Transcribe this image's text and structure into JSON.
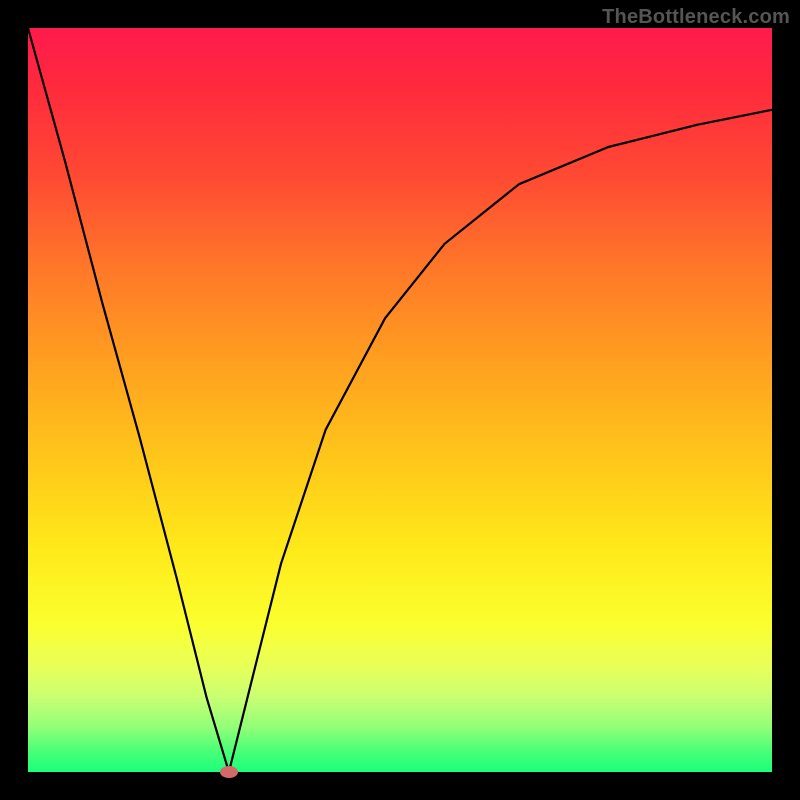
{
  "watermark": "TheBottleneck.com",
  "chart_data": {
    "type": "line",
    "title": "",
    "xlabel": "",
    "ylabel": "",
    "xlim": [
      0,
      100
    ],
    "ylim": [
      0,
      100
    ],
    "grid": false,
    "background_gradient": {
      "top": "#ff1a4d",
      "bottom": "#1aff7a",
      "description": "vertical red-to-green gradient (bottleneck severity heat)"
    },
    "marker": {
      "x": 27,
      "y": 0,
      "color": "#d36a6a",
      "shape": "ellipse"
    },
    "series": [
      {
        "name": "bottleneck-curve",
        "x": [
          0,
          5,
          10,
          15,
          20,
          24,
          27,
          30,
          34,
          40,
          48,
          56,
          66,
          78,
          90,
          100
        ],
        "y": [
          100,
          82,
          63,
          45,
          26,
          10,
          0,
          12,
          28,
          46,
          61,
          71,
          79,
          84,
          87,
          89
        ]
      }
    ],
    "annotations": []
  }
}
